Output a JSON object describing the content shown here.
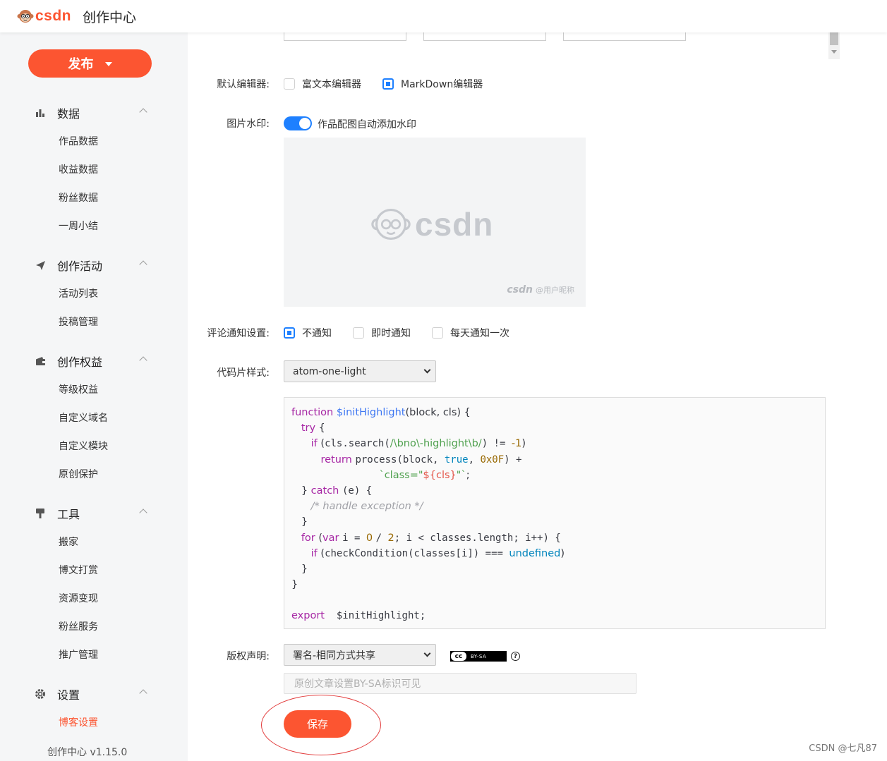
{
  "header": {
    "logo_text": "csdn",
    "title": "创作中心"
  },
  "sidebar": {
    "publish_label": "发布",
    "groups": [
      {
        "title": "数据",
        "icon": "bar-chart-icon",
        "items": [
          "作品数据",
          "收益数据",
          "粉丝数据",
          "一周小结"
        ]
      },
      {
        "title": "创作活动",
        "icon": "paper-plane-icon",
        "items": [
          "活动列表",
          "投稿管理"
        ]
      },
      {
        "title": "创作权益",
        "icon": "wallet-icon",
        "items": [
          "等级权益",
          "自定义域名",
          "自定义模块",
          "原创保护"
        ]
      },
      {
        "title": "工具",
        "icon": "brush-icon",
        "items": [
          "搬家",
          "博文打赏",
          "资源变现",
          "粉丝服务",
          "推广管理"
        ]
      },
      {
        "title": "设置",
        "icon": "gear-icon",
        "items": [
          "博客设置"
        ]
      }
    ],
    "active_item": "博客设置",
    "version": "创作中心 v1.15.0"
  },
  "settings": {
    "editor": {
      "label": "默认编辑器:",
      "options": [
        "富文本编辑器",
        "MarkDown编辑器"
      ],
      "selected": "MarkDown编辑器"
    },
    "watermark": {
      "label": "图片水印:",
      "toggle_label": "作品配图自动添加水印",
      "enabled": true,
      "preview_logo": "csdn",
      "preview_corner_brand": "csdn",
      "preview_corner_user": "@用户昵称"
    },
    "comment_notify": {
      "label": "评论通知设置:",
      "options": [
        "不通知",
        "即时通知",
        "每天通知一次"
      ],
      "selected": "不通知"
    },
    "code_style": {
      "label": "代码片样式:",
      "value": "atom-one-light"
    },
    "copyright": {
      "label": "版权声明:",
      "value": "署名-相同方式共享",
      "badge_cc": "cc",
      "badge_text": "BY-SA",
      "help": "?",
      "placeholder": "原创文章设置BY-SA标识可见"
    },
    "save_label": "保存"
  },
  "code_sample": {
    "fn_name": "$initHighlight",
    "args": "(block, cls) {",
    "regex": "/\\bno\\-highlight\\b/",
    "comment": "/* handle exception */",
    "export_kw": "export",
    "export_line": "  $initHighlight;"
  },
  "footer": {
    "watermark": "CSDN @七凡87"
  },
  "colors": {
    "brand": "#fc5531",
    "accent": "#1e80ff"
  }
}
